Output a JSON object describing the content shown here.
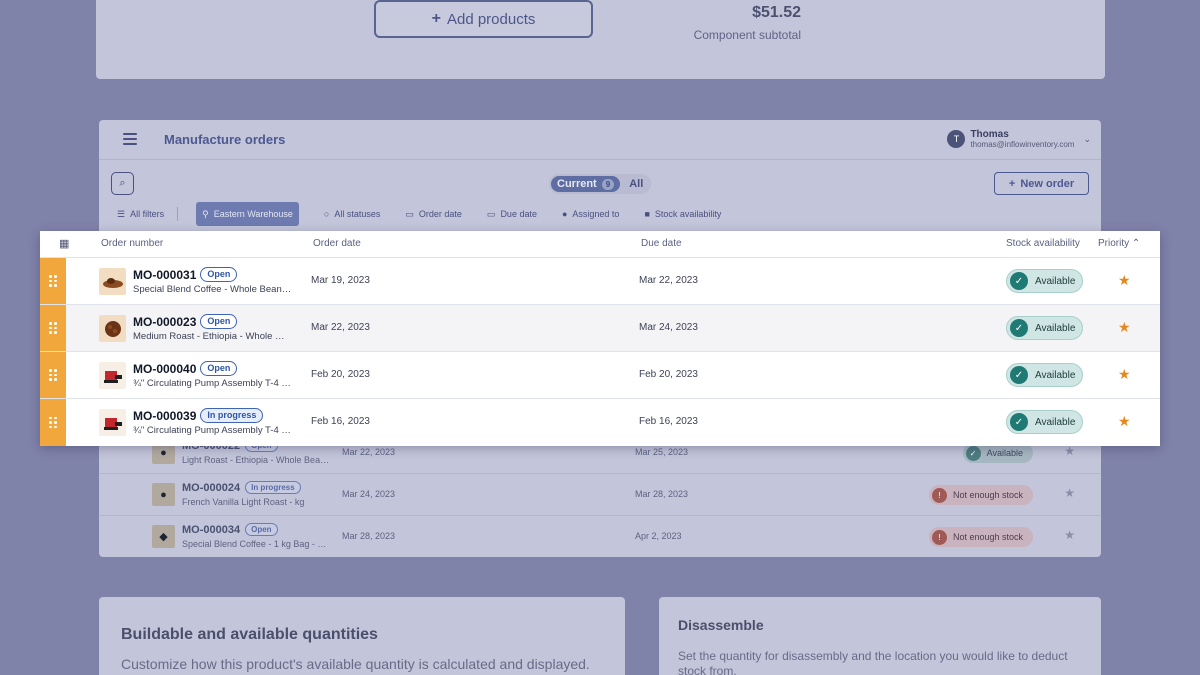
{
  "top_card": {
    "add_products_label": "Add products",
    "subtotal_amount": "$51.52",
    "subtotal_label": "Component subtotal"
  },
  "header": {
    "title": "Manufacture orders",
    "user_initial": "T",
    "user_name": "Thomas",
    "user_email": "thomas@inflowinventory.com"
  },
  "tabs": {
    "current_label": "Current",
    "current_count": "9",
    "all_label": "All"
  },
  "new_order_label": "New order",
  "filters": [
    {
      "label": "All filters",
      "icon": "sliders-icon"
    },
    {
      "label": "Eastern Warehouse",
      "icon": "location-pin-icon"
    },
    {
      "label": "All statuses",
      "icon": "circle-icon"
    },
    {
      "label": "Order date",
      "icon": "calendar-icon"
    },
    {
      "label": "Due date",
      "icon": "calendar-icon"
    },
    {
      "label": "Assigned to",
      "icon": "person-icon"
    },
    {
      "label": "Stock availability",
      "icon": "box-icon"
    }
  ],
  "table": {
    "columns": {
      "order_number": "Order number",
      "order_date": "Order date",
      "due_date": "Due date",
      "stock": "Stock availability",
      "priority": "Priority"
    },
    "focused_rows": [
      {
        "number": "MO-000031",
        "status": "Open",
        "desc": "Special Blend Coffee - Whole Bean…",
        "order_date": "Mar 19, 2023",
        "due_date": "Mar 22, 2023",
        "stock": "Available",
        "thumb": "coffee"
      },
      {
        "number": "MO-000023",
        "status": "Open",
        "desc": "Medium Roast - Ethiopia - Whole …",
        "order_date": "Mar 22, 2023",
        "due_date": "Mar 24, 2023",
        "stock": "Available",
        "thumb": "coffee"
      },
      {
        "number": "MO-000040",
        "status": "Open",
        "desc": "¾\" Circulating Pump Assembly T-4 …",
        "order_date": "Feb 20, 2023",
        "due_date": "Feb 20, 2023",
        "stock": "Available",
        "thumb": "pump"
      },
      {
        "number": "MO-000039",
        "status": "In progress",
        "desc": "¾\" Circulating Pump Assembly T-4 …",
        "order_date": "Feb 16, 2023",
        "due_date": "Feb 16, 2023",
        "stock": "Available",
        "thumb": "pump"
      }
    ],
    "dim_rows": [
      {
        "number": "MO-000022",
        "status": "Open",
        "desc": "Light Roast - Ethiopia - Whole Bea…",
        "order_date": "Mar 22, 2023",
        "due_date": "Mar 25, 2023",
        "stock": "Available",
        "ok": true
      },
      {
        "number": "MO-000024",
        "status": "In progress",
        "desc": "French Vanilla Light Roast - kg",
        "order_date": "Mar 24, 2023",
        "due_date": "Mar 28, 2023",
        "stock": "Not enough stock",
        "ok": false
      },
      {
        "number": "MO-000034",
        "status": "Open",
        "desc": "Special Blend Coffee - 1 kg Bag - …",
        "order_date": "Mar 28, 2023",
        "due_date": "Apr 2, 2023",
        "stock": "Not enough stock",
        "ok": false
      }
    ]
  },
  "bottom": {
    "buildable_title": "Buildable and available quantities",
    "buildable_desc": "Customize how this product's available quantity is calculated and displayed.",
    "disassemble_title": "Disassemble",
    "disassemble_desc": "Set the quantity for disassembly and the location you would like to deduct stock from."
  },
  "colors": {
    "accent_orange": "#f1a73c",
    "star": "#e5891f",
    "available_green": "#1f7a74",
    "badge_blue": "#3f63b7"
  }
}
